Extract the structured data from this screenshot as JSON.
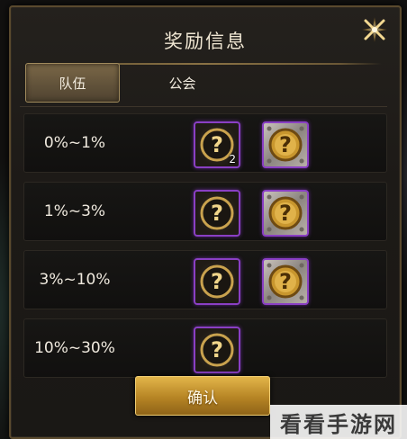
{
  "dialog": {
    "title": "奖励信息",
    "close_icon": "close-x-star-icon"
  },
  "tabs": [
    {
      "label": "队伍",
      "active": true
    },
    {
      "label": "公会",
      "active": false
    }
  ],
  "rows": [
    {
      "label": "0%~1%",
      "items": [
        {
          "icon": "mystery-box-dark-icon",
          "quantity": "2"
        },
        {
          "icon": "mystery-box-gold-icon",
          "quantity": ""
        }
      ]
    },
    {
      "label": "1%~3%",
      "items": [
        {
          "icon": "mystery-box-dark-icon",
          "quantity": ""
        },
        {
          "icon": "mystery-box-gold-icon",
          "quantity": ""
        }
      ]
    },
    {
      "label": "3%~10%",
      "items": [
        {
          "icon": "mystery-box-dark-icon",
          "quantity": ""
        },
        {
          "icon": "mystery-box-gold-icon",
          "quantity": ""
        }
      ]
    },
    {
      "label": "10%~30%",
      "items": [
        {
          "icon": "mystery-box-dark-icon",
          "quantity": ""
        }
      ]
    }
  ],
  "confirm_label": "确认",
  "watermark": "看看手游网"
}
